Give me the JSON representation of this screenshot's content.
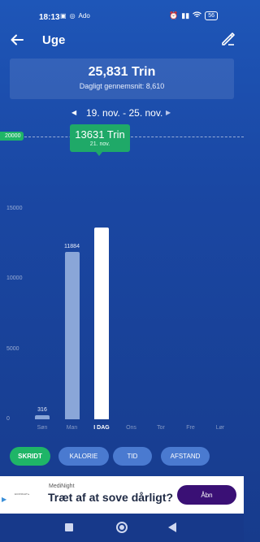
{
  "status": {
    "time": "18:13",
    "left_icons": [
      "notification-icon",
      "instagram-icon"
    ],
    "left_badge": "Ado",
    "right_icons": [
      "alarm-icon",
      "signal-icon",
      "wifi-icon"
    ],
    "battery": "56"
  },
  "header": {
    "title": "Uge",
    "back_icon": "arrow-left-icon",
    "edit_icon": "pencil-icon"
  },
  "summary": {
    "total": "25,831 Trin",
    "average_label": "Dagligt gennemsnit:",
    "average_value": "8,610"
  },
  "range": {
    "label": "19. nov. - 25. nov.",
    "prev_icon": "triangle-left-icon",
    "next_icon": "triangle-right-icon"
  },
  "goal": {
    "label": "20000",
    "value": 20000
  },
  "tooltip": {
    "value": "13631 Trin",
    "date": "21. nov."
  },
  "chart_data": {
    "type": "bar",
    "categories": [
      "Søn",
      "Man",
      "I DAG",
      "Ons",
      "Tor",
      "Fre",
      "Lør"
    ],
    "values": [
      316,
      11884,
      13631,
      0,
      0,
      0,
      0
    ],
    "value_labels": [
      "316",
      "11884",
      "",
      "",
      "",
      "",
      ""
    ],
    "selected_index": 2,
    "y_ticks": [
      "0",
      "5000",
      "10000",
      "15000"
    ],
    "ylim": [
      0,
      20000
    ],
    "goal": 20000,
    "colors": {
      "normal": "#8aa6d8",
      "selected": "#ffffff",
      "goal": "#1fb567"
    }
  },
  "tabs": [
    {
      "label": "SKRIDT",
      "active": true
    },
    {
      "label": "KALORIE",
      "active": false
    },
    {
      "label": "TID",
      "active": false
    },
    {
      "label": "AFSTAND",
      "active": false
    }
  ],
  "ad": {
    "sponsor": "MediNight",
    "headline": "Træt af at sove dårligt?",
    "button": "Åbn",
    "brand_small": "ECONIGHT ▸",
    "ad_icon": "play-triangle-icon"
  },
  "navbar": [
    "recent-apps-icon",
    "home-icon",
    "back-triangle-icon"
  ],
  "colors": {
    "accent": "#1fb567",
    "background": "#1a47a3",
    "ad_button": "#3a1075"
  }
}
